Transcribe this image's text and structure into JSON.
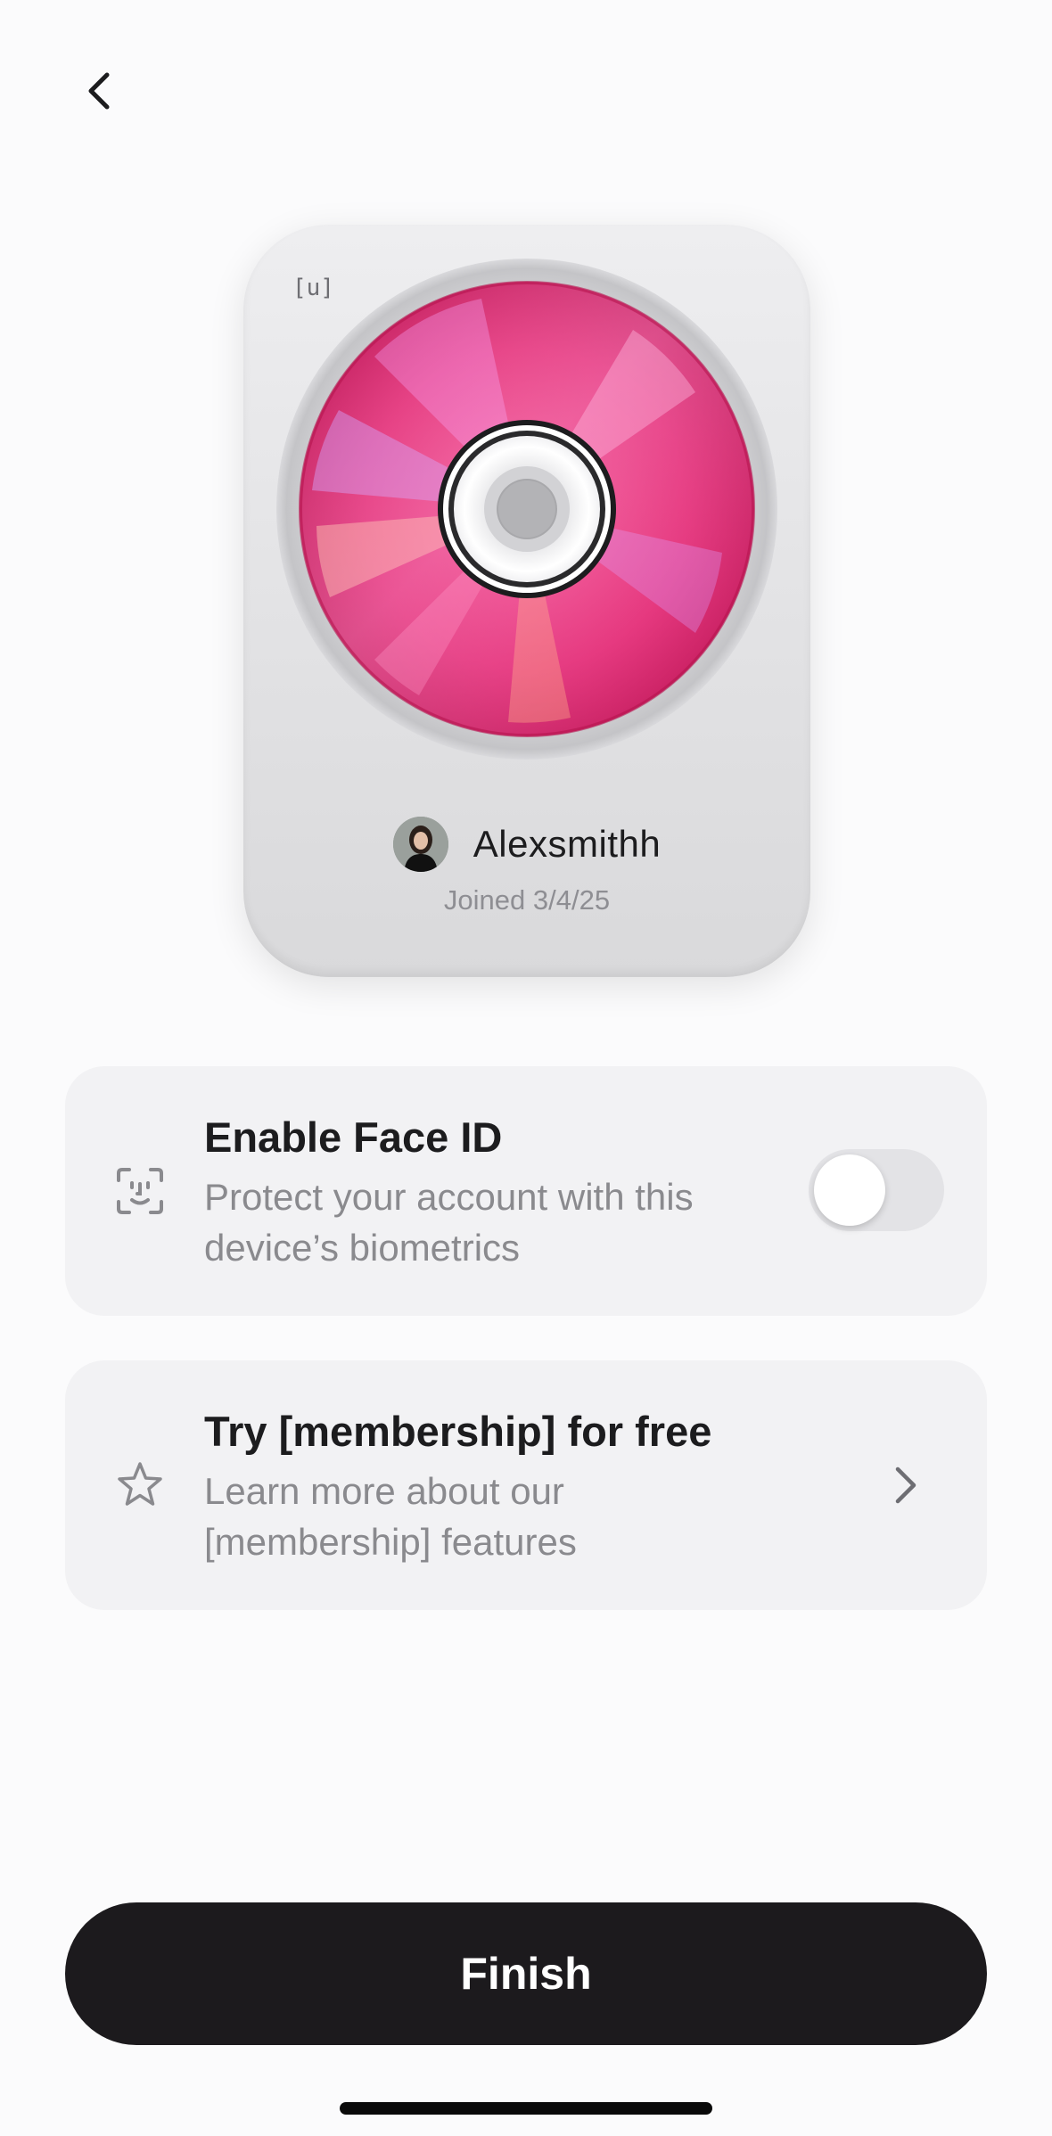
{
  "nav": {
    "back_icon": "chevron-left-icon"
  },
  "card": {
    "tag": "[u]",
    "disc_colors": [
      "#e0226b",
      "#f25a9a",
      "#b9248a",
      "#ff9ad0"
    ],
    "username": "Alexsmithh",
    "joined": "Joined 3/4/25"
  },
  "options": {
    "face_id": {
      "icon": "face-id-icon",
      "title": "Enable Face ID",
      "description": "Protect your account with this device’s biometrics",
      "enabled": false
    },
    "membership": {
      "icon": "star-icon",
      "title": "Try [membership] for free",
      "description": "Learn more about our [membership] features",
      "chevron_icon": "chevron-right-icon"
    }
  },
  "footer": {
    "finish_label": "Finish",
    "finish_color": "#1c1a1d"
  }
}
